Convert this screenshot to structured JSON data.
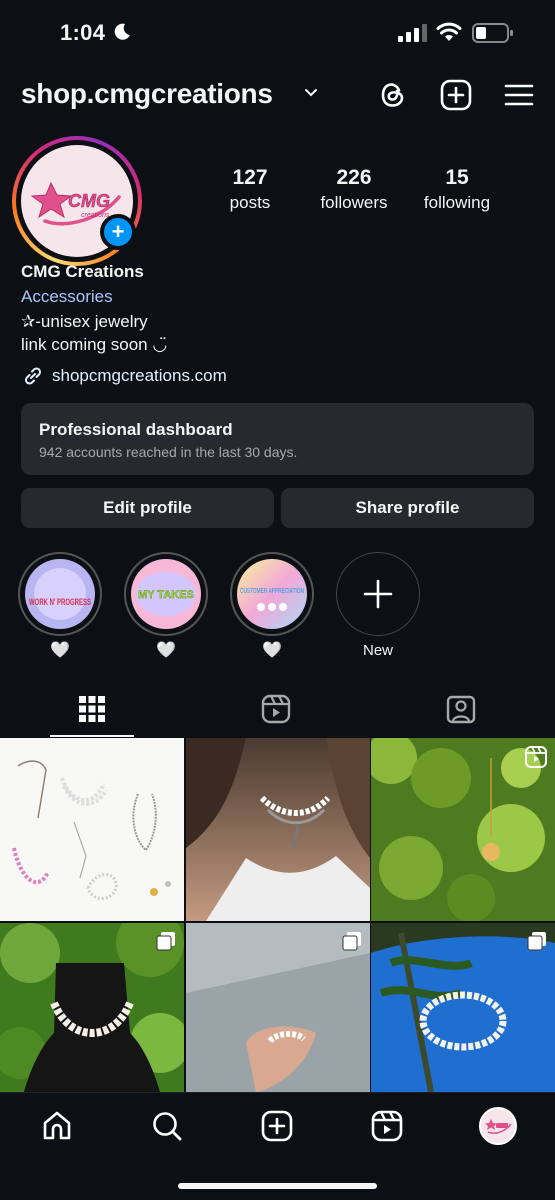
{
  "status_bar": {
    "time": "1:04"
  },
  "header": {
    "username": "shop.cmgcreations"
  },
  "avatar": {
    "logo_text": "CMG",
    "logo_sub": "creations"
  },
  "stats": [
    {
      "num": "127",
      "label": "posts"
    },
    {
      "num": "226",
      "label": "followers"
    },
    {
      "num": "15",
      "label": "following"
    }
  ],
  "bio": {
    "name": "CMG Creations",
    "category": "Accessories",
    "line1": "✰-unisex jewelry",
    "line2": "link coming soon ◡̈",
    "link": "shopcmgcreations.com"
  },
  "dashboard": {
    "title": "Professional dashboard",
    "subtitle": "942 accounts reached in the last 30 days."
  },
  "buttons": {
    "edit": "Edit profile",
    "share": "Share profile"
  },
  "highlights": [
    {
      "title": "WORK N' PROGRESS",
      "label": "🤍"
    },
    {
      "title": "MY TAKES",
      "label": "🤍"
    },
    {
      "title": "CUSTOMER APPRECIATION",
      "label": "🤍"
    },
    {
      "title": "",
      "label": "New"
    }
  ],
  "colors": {
    "background": "#0c1014",
    "accent": "#0095f6",
    "link": "#a8c7fa",
    "card": "#262a2e"
  }
}
